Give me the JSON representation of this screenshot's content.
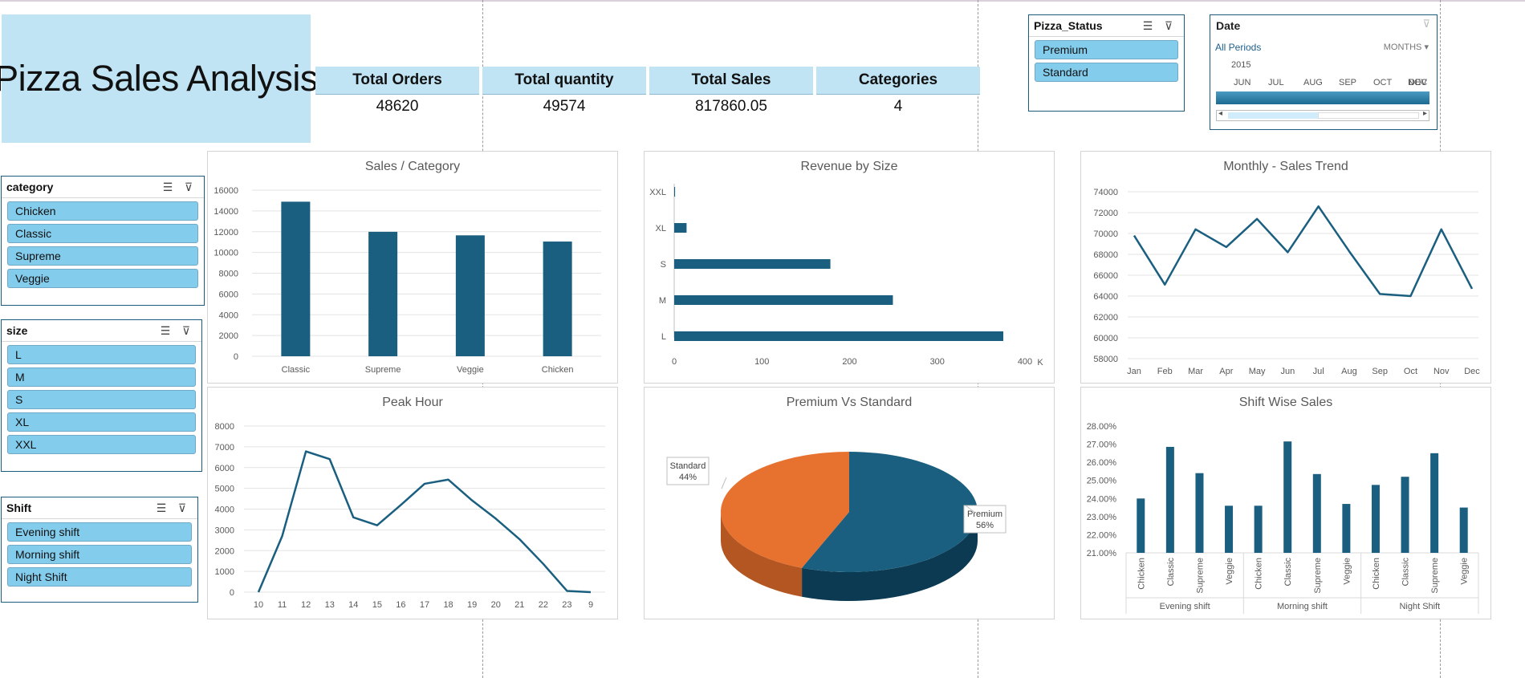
{
  "header": {
    "title": "Pizza Sales Analysis"
  },
  "kpis": [
    {
      "label": "Total Orders",
      "value": "48620"
    },
    {
      "label": "Total quantity",
      "value": "49574"
    },
    {
      "label": "Total Sales",
      "value": "817860.05"
    },
    {
      "label": "Categories",
      "value": "4"
    }
  ],
  "slicers": {
    "pizza_status": {
      "title": "Pizza_Status",
      "items": [
        "Premium",
        "Standard"
      ]
    },
    "category": {
      "title": "category",
      "items": [
        "Chicken",
        "Classic",
        "Supreme",
        "Veggie"
      ]
    },
    "size": {
      "title": "size",
      "items": [
        "L",
        "M",
        "S",
        "XL",
        "XXL"
      ]
    },
    "shift": {
      "title": "Shift",
      "items": [
        "Evening shift",
        "Morning shift",
        "Night Shift"
      ]
    }
  },
  "date_slicer": {
    "title": "Date",
    "period": "All Periods",
    "level": "MONTHS",
    "year": "2015",
    "months": [
      "JUN",
      "JUL",
      "AUG",
      "SEP",
      "OCT",
      "NOV",
      "DEC"
    ]
  },
  "icons": {
    "multi_select": "multi-select-icon",
    "clear_filter": "clear-filter-icon"
  },
  "colors": {
    "primary": "#1a5f7f",
    "accent": "#e7712f",
    "header_bg": "#c1e4f5",
    "slicer_item": "#83ccec"
  },
  "chart_data": [
    {
      "id": "sales_category",
      "type": "bar",
      "title": "Sales / Category",
      "categories": [
        "Classic",
        "Supreme",
        "Veggie",
        "Chicken"
      ],
      "values": [
        14888,
        11987,
        11649,
        11050
      ],
      "ylim": [
        0,
        16000
      ],
      "yticks": [
        0,
        2000,
        4000,
        6000,
        8000,
        10000,
        12000,
        14000,
        16000
      ],
      "grid": true
    },
    {
      "id": "revenue_size",
      "type": "bar",
      "orientation": "horizontal",
      "title": "Revenue by Size",
      "categories": [
        "L",
        "M",
        "S",
        "XL",
        "XXL"
      ],
      "values": [
        375.3,
        249.4,
        178.1,
        14.1,
        1.0
      ],
      "xlim": [
        0,
        400
      ],
      "xticks": [
        0,
        100,
        200,
        300,
        400
      ],
      "xunit": "K",
      "grid": false
    },
    {
      "id": "monthly_trend",
      "type": "line",
      "title": "Monthly - Sales Trend",
      "categories": [
        "Jan",
        "Feb",
        "Mar",
        "Apr",
        "May",
        "Jun",
        "Jul",
        "Aug",
        "Sep",
        "Oct",
        "Nov",
        "Dec"
      ],
      "values": [
        69800,
        65100,
        70400,
        68700,
        71400,
        68200,
        72600,
        68300,
        64200,
        64000,
        70400,
        64700
      ],
      "ylim": [
        58000,
        74000
      ],
      "yticks": [
        58000,
        60000,
        62000,
        64000,
        66000,
        68000,
        70000,
        72000,
        74000
      ],
      "grid": true
    },
    {
      "id": "peak_hour",
      "type": "line",
      "title": "Peak Hour",
      "categories": [
        "10",
        "11",
        "12",
        "13",
        "14",
        "15",
        "16",
        "17",
        "18",
        "19",
        "20",
        "21",
        "22",
        "23",
        "9"
      ],
      "values": [
        0,
        2700,
        6780,
        6410,
        3600,
        3220,
        4200,
        5220,
        5420,
        4420,
        3540,
        2550,
        1360,
        60,
        0
      ],
      "ylim": [
        0,
        8000
      ],
      "yticks": [
        0,
        1000,
        2000,
        3000,
        4000,
        5000,
        6000,
        7000,
        8000
      ],
      "grid": true
    },
    {
      "id": "premium_standard",
      "type": "pie",
      "title": "Premium Vs Standard",
      "labels": [
        "Premium",
        "Standard"
      ],
      "values": [
        56,
        44
      ],
      "data_labels": [
        [
          "Premium",
          "56%"
        ],
        [
          "Standard",
          "44%"
        ]
      ]
    },
    {
      "id": "shift_sales",
      "type": "bar",
      "title": "Shift Wise Sales",
      "groups": [
        "Evening shift",
        "Morning shift",
        "Night Shift"
      ],
      "categories": [
        "Chicken",
        "Classic",
        "Supreme",
        "Veggie"
      ],
      "series": [
        {
          "values": [
            24.0,
            26.85,
            25.4,
            23.6
          ]
        },
        {
          "values": [
            23.6,
            27.15,
            25.35,
            23.7
          ]
        },
        {
          "values": [
            24.75,
            25.2,
            26.5,
            23.5
          ]
        }
      ],
      "ylim": [
        21,
        28
      ],
      "yticks": [
        "21.00%",
        "22.00%",
        "23.00%",
        "24.00%",
        "25.00%",
        "26.00%",
        "27.00%",
        "28.00%"
      ],
      "grid": false
    }
  ]
}
